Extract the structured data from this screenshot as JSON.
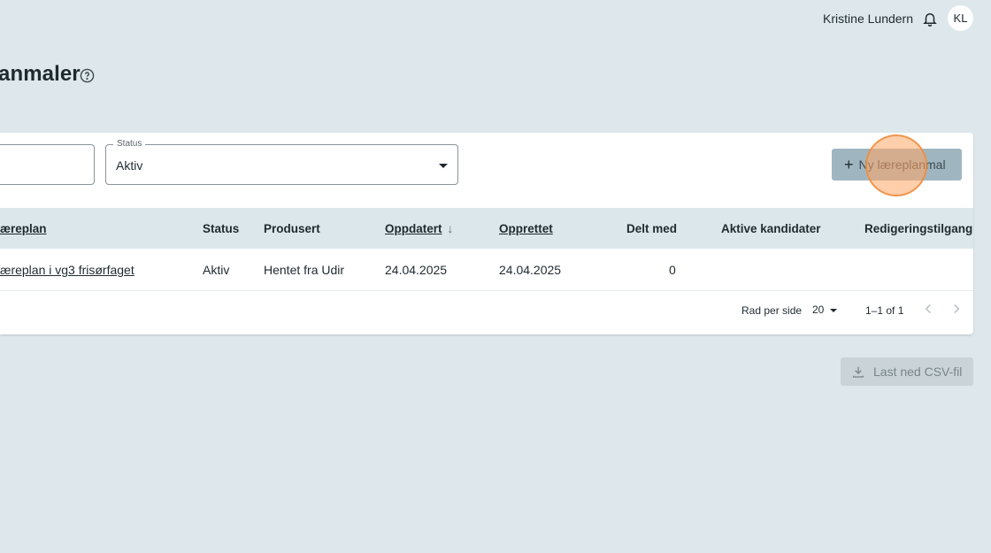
{
  "header": {
    "user_name": "Kristine Lundern",
    "avatar_initials": "KL",
    "bell_icon": "bell-icon"
  },
  "page": {
    "title": "anmaler",
    "help_icon": "help-circle-icon"
  },
  "filters": {
    "search_value": "",
    "status_label": "Status",
    "status_value": "Aktiv"
  },
  "actions": {
    "new_button_label": "Ny læreplanmal",
    "csv_button_label": "Last ned CSV-fil"
  },
  "table": {
    "columns": [
      "æreplan",
      "Status",
      "Produsert",
      "Oppdatert",
      "Opprettet",
      "Delt med",
      "Aktive kandidater",
      "Redigeringstilgang"
    ],
    "rows": [
      {
        "name": "æreplan i vg3 frisørfaget",
        "status": "Aktiv",
        "produsert": "Hentet fra Udir",
        "oppdatert": "24.04.2025",
        "opprettet": "24.04.2025",
        "delt_med": "0",
        "aktive_kandidater": "",
        "redigeringstilgang": ""
      }
    ]
  },
  "pagination": {
    "rows_per_page_label": "Rad per side",
    "rows_per_page_value": "20",
    "range_label": "1–1 of 1"
  },
  "colors": {
    "background": "#dde7ec",
    "primary_button": "#9fb6c0",
    "table_header": "#dce7ec"
  }
}
